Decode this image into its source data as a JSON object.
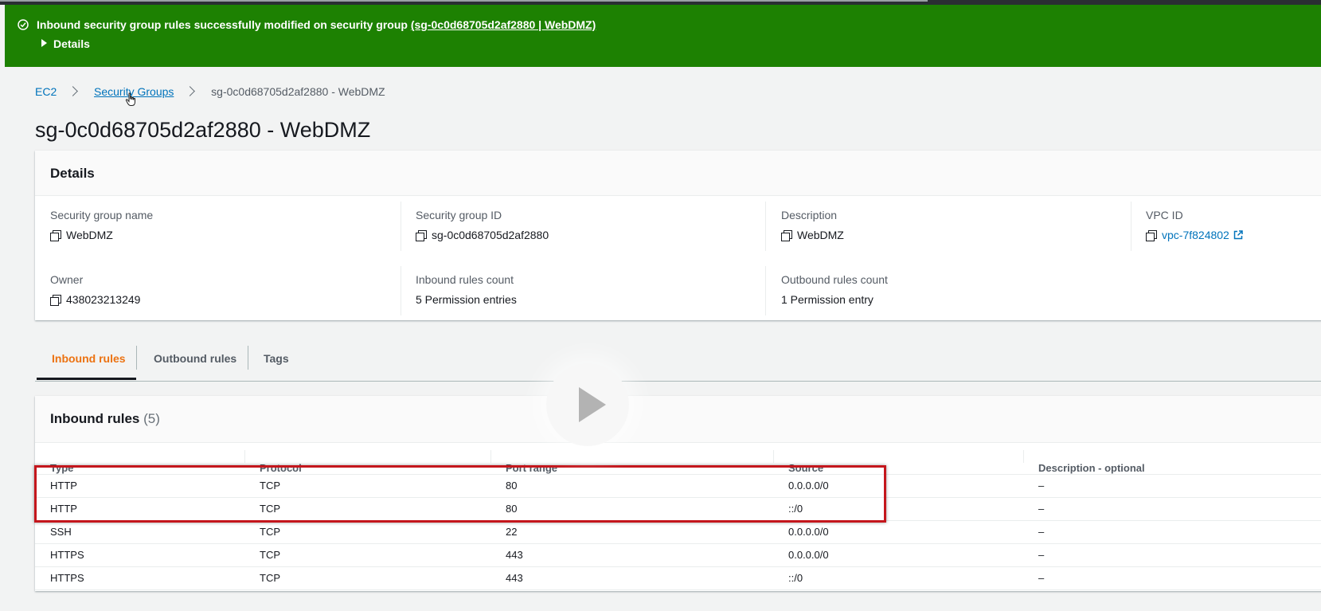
{
  "flash": {
    "message": "Inbound security group rules successfully modified on security group",
    "link": "(sg-0c0d68705d2af2880 | WebDMZ)",
    "details": "Details"
  },
  "breadcrumb": {
    "ec2": "EC2",
    "security_groups": "Security Groups",
    "current": "sg-0c0d68705d2af2880 - WebDMZ"
  },
  "page_title": "sg-0c0d68705d2af2880 - WebDMZ",
  "details": {
    "heading": "Details",
    "fields": {
      "sg_name": {
        "label": "Security group name",
        "value": "WebDMZ"
      },
      "sg_id": {
        "label": "Security group ID",
        "value": "sg-0c0d68705d2af2880"
      },
      "description": {
        "label": "Description",
        "value": "WebDMZ"
      },
      "vpc_id": {
        "label": "VPC ID",
        "value": "vpc-7f824802"
      },
      "owner": {
        "label": "Owner",
        "value": "438023213249"
      },
      "inbound_count": {
        "label": "Inbound rules count",
        "value": "5 Permission entries"
      },
      "outbound_count": {
        "label": "Outbound rules count",
        "value": "1 Permission entry"
      }
    }
  },
  "tabs": {
    "inbound": "Inbound rules",
    "outbound": "Outbound rules",
    "tags": "Tags"
  },
  "inbound_rules": {
    "title": "Inbound rules",
    "count": "(5)",
    "columns": {
      "type": "Type",
      "protocol": "Protocol",
      "port_range": "Port range",
      "source": "Source",
      "description": "Description - optional"
    },
    "rows": [
      {
        "type": "HTTP",
        "protocol": "TCP",
        "port_range": "80",
        "source": "0.0.0.0/0",
        "description": "–"
      },
      {
        "type": "HTTP",
        "protocol": "TCP",
        "port_range": "80",
        "source": "::/0",
        "description": "–"
      },
      {
        "type": "SSH",
        "protocol": "TCP",
        "port_range": "22",
        "source": "0.0.0.0/0",
        "description": "–"
      },
      {
        "type": "HTTPS",
        "protocol": "TCP",
        "port_range": "443",
        "source": "0.0.0.0/0",
        "description": "–"
      },
      {
        "type": "HTTPS",
        "protocol": "TCP",
        "port_range": "443",
        "source": "::/0",
        "description": "–"
      }
    ]
  },
  "colors": {
    "success": "#1d8102",
    "link": "#0073bb",
    "tab_active": "#ec7211",
    "highlight": "#c4161c"
  },
  "icons": {
    "flash": "check-circle-icon",
    "copy": "copy-icon",
    "external": "external-link-icon",
    "video": "play-icon"
  }
}
